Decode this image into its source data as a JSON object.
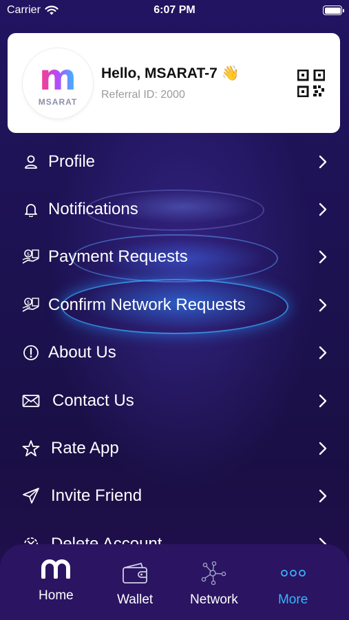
{
  "status_bar": {
    "carrier": "Carrier",
    "time": "6:07 PM"
  },
  "header_card": {
    "logo_text": "MSARAT",
    "greeting": "Hello, MSARAT-7",
    "wave_emoji": "👋",
    "referral": "Referral ID: 2000",
    "qr_icon": "qr-code-icon"
  },
  "menu": {
    "items": [
      {
        "label": "Profile",
        "icon": "person-icon"
      },
      {
        "label": "Notifications",
        "icon": "bell-icon"
      },
      {
        "label": "Payment Requests",
        "icon": "money-hand-icon"
      },
      {
        "label": "Confirm Network Requests",
        "icon": "money-hand-icon"
      },
      {
        "label": "About Us",
        "icon": "info-icon"
      },
      {
        "label": "Contact Us",
        "icon": "envelope-icon"
      },
      {
        "label": "Rate App",
        "icon": "star-icon"
      },
      {
        "label": "Invite Friend",
        "icon": "send-icon"
      },
      {
        "label": "Delete Account",
        "icon": "delete-gear-icon"
      }
    ]
  },
  "tabbar": {
    "tabs": [
      {
        "label": "Home",
        "icon": "msarat-logo-icon",
        "active": false
      },
      {
        "label": "Wallet",
        "icon": "wallet-icon",
        "active": false
      },
      {
        "label": "Network",
        "icon": "network-icon",
        "active": false
      },
      {
        "label": "More",
        "icon": "more-dots-icon",
        "active": true
      }
    ]
  },
  "colors": {
    "background": "#1b1148",
    "tabbar": "#2b1461",
    "active_tab": "#34b6ff"
  }
}
